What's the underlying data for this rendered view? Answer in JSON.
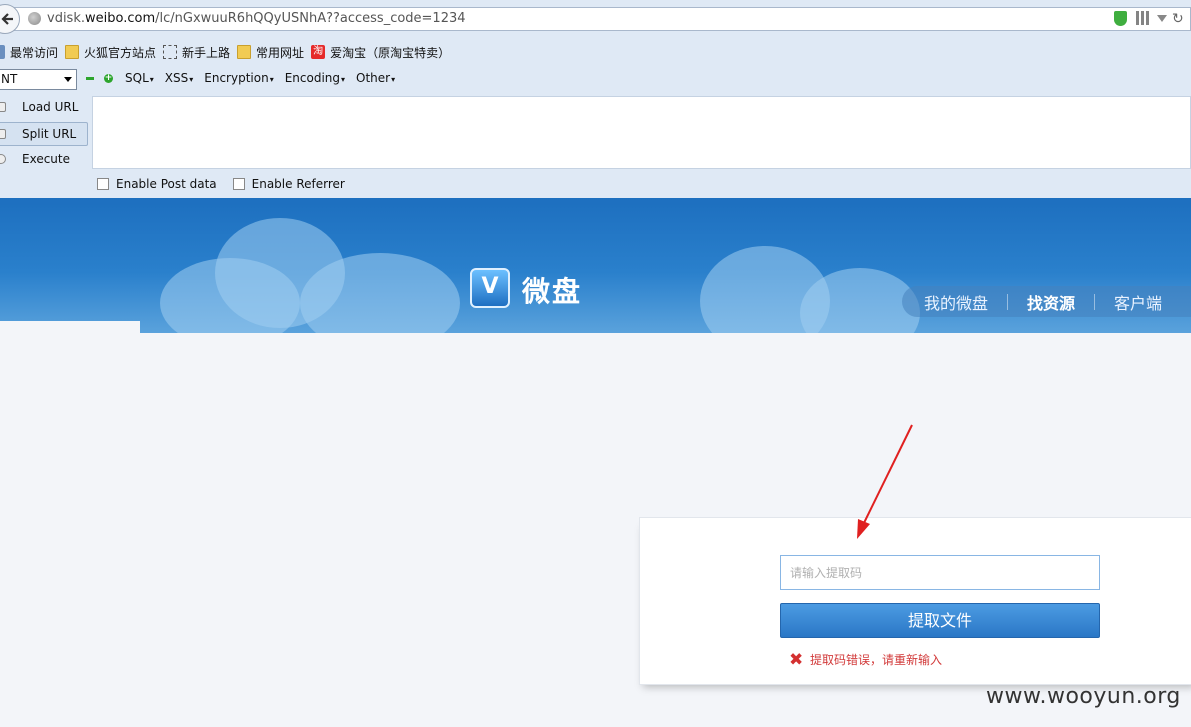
{
  "browser": {
    "url_prefix": "vdisk.",
    "url_domain": "weibo.com",
    "url_rest": "/lc/nGxwuuR6hQQyUSNhA??access_code=1234"
  },
  "bookmarks": [
    {
      "label": "最常访问",
      "icon": "doc-icon"
    },
    {
      "label": "火狐官方站点",
      "icon": "folder-icon"
    },
    {
      "label": "新手上路",
      "icon": "dashed-box-icon"
    },
    {
      "label": "常用网址",
      "icon": "folder-icon"
    },
    {
      "label": "爱淘宝（原淘宝特卖）",
      "icon": "taobao-icon",
      "icon_glyph": "淘"
    }
  ],
  "hackbar": {
    "select_value": "NT",
    "menus": [
      "SQL",
      "XSS",
      "Encryption",
      "Encoding",
      "Other"
    ],
    "load_url": "Load URL",
    "split_url": "Split URL",
    "execute": "Execute",
    "post_data": "Enable Post data",
    "referrer": "Enable Referrer"
  },
  "site": {
    "logo_letter": "V",
    "logo_text": "微盘",
    "nav": [
      "我的微盘",
      "找资源",
      "客户端"
    ],
    "input_placeholder": "请输入提取码",
    "button_label": "提取文件",
    "error_text": "提取码错误，请重新输入",
    "error_icon": "✖"
  },
  "watermark": "www.wooyun.org",
  "colors": {
    "banner": "#2a80cc",
    "button": "#3a88d6",
    "error": "#d23a3a",
    "arrow": "#e02020"
  }
}
